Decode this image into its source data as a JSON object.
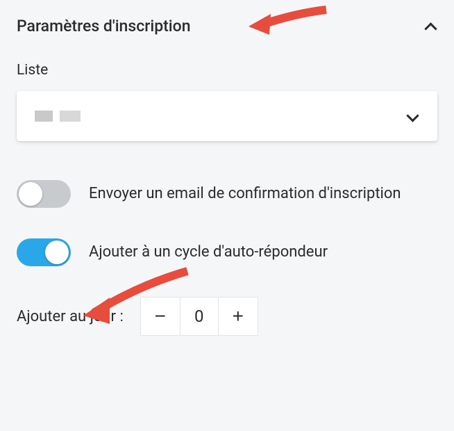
{
  "section": {
    "title": "Paramètres d'inscription"
  },
  "list": {
    "label": "Liste",
    "selected": ""
  },
  "toggles": {
    "confirmEmail": {
      "label": "Envoyer un email de confirmation d'inscription",
      "on": false
    },
    "autoresponder": {
      "label": "Ajouter à un cycle d'auto-répondeur",
      "on": true
    }
  },
  "stepper": {
    "label": "Ajouter au jour :",
    "value": "0"
  }
}
